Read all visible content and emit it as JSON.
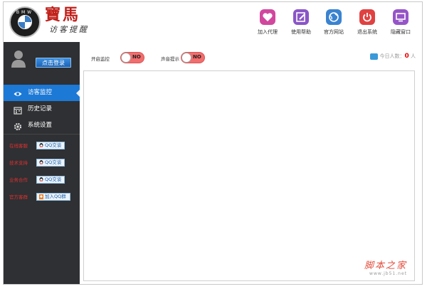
{
  "brand": {
    "logo_text": "BMW",
    "title": "寶馬",
    "subtitle": "访客提醒"
  },
  "top_buttons": [
    {
      "id": "add-agent",
      "label": "加入代理",
      "icon": "heart-icon",
      "color": "#d1479e"
    },
    {
      "id": "help",
      "label": "使用帮助",
      "icon": "edit-icon",
      "color": "#8a55c7"
    },
    {
      "id": "website",
      "label": "官方网站",
      "icon": "globe-icon",
      "color": "#3a83d1"
    },
    {
      "id": "exit",
      "label": "退出系统",
      "icon": "power-icon",
      "color": "#e04141"
    },
    {
      "id": "hide",
      "label": "隐藏窗口",
      "icon": "monitor-icon",
      "color": "#9555c8"
    }
  ],
  "sidebar": {
    "login_label": "点击登录",
    "items": [
      {
        "label": "访客监控",
        "icon": "eye-icon",
        "active": true
      },
      {
        "label": "历史记录",
        "icon": "calendar-icon",
        "active": false
      },
      {
        "label": "系统设置",
        "icon": "gear-icon",
        "active": false
      }
    ],
    "contacts": [
      {
        "label": "在线客服",
        "button": "QQ交谈"
      },
      {
        "label": "技术支持",
        "button": "QQ交谈"
      },
      {
        "label": "业务合作",
        "button": "QQ交谈"
      },
      {
        "label": "官方客群",
        "button": "加入QQ群"
      }
    ]
  },
  "toolbar": {
    "monitor_label": "开启监控",
    "monitor_state": "NO",
    "sound_label": "声音提示",
    "sound_state": "NO",
    "visitors_label": "今日人数：",
    "visitors_count": "0",
    "visitors_unit": "人"
  },
  "watermark": {
    "main": "脚本之家",
    "sub": "www.jb51.net"
  },
  "colors": {
    "sidebar_bg": "#2e3033",
    "active_item": "#1c79d6",
    "toggle_off": "#f26d6d",
    "accent_red": "#e03030"
  }
}
